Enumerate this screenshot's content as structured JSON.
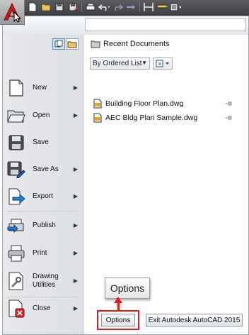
{
  "toolbar": {
    "icons": [
      "autocad-logo-icon",
      "new-icon",
      "open-icon",
      "save-icon",
      "save-as-icon",
      "print-icon",
      "undo-icon",
      "redo-icon",
      "match-properties-icon",
      "workspace-icon",
      "layer-icon",
      "customize-dropdown-icon"
    ]
  },
  "menu": {
    "search": {
      "placeholder": ""
    },
    "nav": [
      {
        "id": "new",
        "label": "New",
        "submenu": true,
        "icon": "new-document-icon"
      },
      {
        "id": "open",
        "label": "Open",
        "submenu": true,
        "icon": "open-folder-icon"
      },
      {
        "id": "save",
        "label": "Save",
        "submenu": false,
        "icon": "save-floppy-icon"
      },
      {
        "id": "save-as",
        "label": "Save As",
        "submenu": true,
        "icon": "save-as-icon"
      },
      {
        "id": "export",
        "label": "Export",
        "submenu": true,
        "icon": "export-icon"
      },
      {
        "id": "publish",
        "label": "Publish",
        "submenu": true,
        "icon": "publish-icon"
      },
      {
        "id": "print",
        "label": "Print",
        "submenu": true,
        "icon": "printer-icon"
      },
      {
        "id": "drawing-utilities",
        "label": "Drawing Utilities",
        "submenu": true,
        "icon": "drawing-utilities-icon"
      },
      {
        "id": "close",
        "label": "Close",
        "submenu": true,
        "icon": "close-document-icon"
      }
    ],
    "recent": {
      "title": "Recent Documents",
      "order_by": "By Ordered List",
      "documents": [
        {
          "name": "Building Floor Plan.dwg"
        },
        {
          "name": "AEC Bldg Plan Sample.dwg"
        }
      ]
    },
    "tooltip": {
      "text": "Options"
    },
    "buttons": {
      "options": "Options",
      "exit": "Exit Autodesk AutoCAD 2015"
    }
  },
  "colors": {
    "accent_red": "#e31b1b",
    "toolbar_dark": "#4a4c50",
    "sidebar": "#e2e5e9"
  }
}
